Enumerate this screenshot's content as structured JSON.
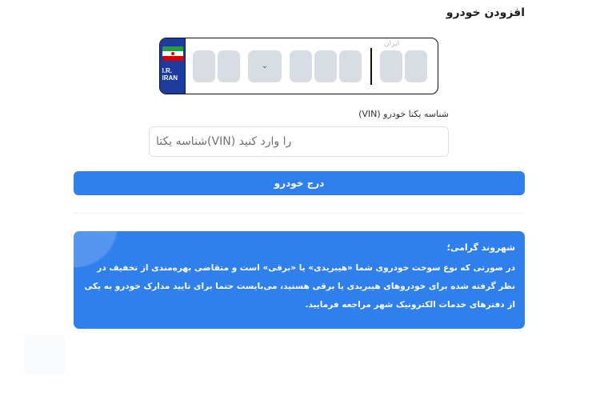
{
  "header": {
    "title": "افزودن خودرو"
  },
  "plate": {
    "country_code": "I.R.\nIRAN",
    "region_label": "ایران",
    "selector_icon": "chevron-down-icon",
    "colors": {
      "strip": "#1d3a9e",
      "box": "#d8dde3"
    }
  },
  "vin": {
    "label": "شناسه یکتا خودرو (VIN)",
    "placeholder": "را وارد کنید (VIN)شناسه یکتا",
    "value": ""
  },
  "actions": {
    "submit_label": "درج خودرو"
  },
  "notice": {
    "title": "شهروند گرامی؛",
    "body": "در صورتی که نوع سوخت خودروی شما «هیبریدی» یا «برقی» است و متقاضی بهره‌مندی از تخفیف در نظر گرفته شده برای خودروهای هیبریدی یا برقی هستید، می‌بایست حتما برای تایید مدارک خودرو به یکی از دفترهای خدمات الکترونیک شهر مراجعه فرمایید."
  },
  "colors": {
    "primary": "#2f80ed",
    "text": "#1e1e1e"
  }
}
